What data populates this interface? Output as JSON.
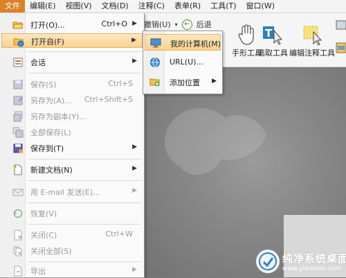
{
  "menubar": {
    "items": [
      "文件",
      "编辑(E)",
      "视图(V)",
      "文档(D)",
      "注释(C)",
      "表单(R)",
      "工具(T)",
      "窗口(W)"
    ]
  },
  "ribbon": {
    "undo": "撤销(U)",
    "back": "后退",
    "tools": [
      "手形工具",
      "选取工具",
      "编辑注释工具"
    ]
  },
  "menu": {
    "items": [
      {
        "label": "打开(O)...",
        "shortcut": "Ctrl+O",
        "arrow": true,
        "icon": "folder-open-icon",
        "disabled": false
      },
      {
        "label": "打开自(F)",
        "shortcut": "",
        "arrow": true,
        "icon": "folder-web-icon",
        "disabled": false
      },
      {
        "label": "会话",
        "shortcut": "",
        "arrow": true,
        "icon": "session-icon",
        "disabled": false
      },
      {
        "label": "保存(S)",
        "shortcut": "Ctrl+S",
        "arrow": false,
        "icon": "save-icon",
        "disabled": true
      },
      {
        "label": "另存为(A)...",
        "shortcut": "Ctrl+Shift+S",
        "arrow": false,
        "icon": "save-as-icon",
        "disabled": true
      },
      {
        "label": "另存为副本(Y)...",
        "shortcut": "",
        "arrow": false,
        "icon": "save-copy-icon",
        "disabled": true
      },
      {
        "label": "全部保存(L)",
        "shortcut": "",
        "arrow": false,
        "icon": "save-all-icon",
        "disabled": true
      },
      {
        "label": "保存到(T)",
        "shortcut": "",
        "arrow": true,
        "icon": "save-to-icon",
        "disabled": false
      },
      {
        "label": "新建文档(N)",
        "shortcut": "",
        "arrow": true,
        "icon": "new-document-icon",
        "disabled": false
      },
      {
        "label": "用 E-mail 发送(E)...",
        "shortcut": "",
        "arrow": true,
        "icon": "email-icon",
        "disabled": true
      },
      {
        "label": "恢复(V)",
        "shortcut": "",
        "arrow": false,
        "icon": "revert-icon",
        "disabled": true
      },
      {
        "label": "关闭(C)",
        "shortcut": "Ctrl+W",
        "arrow": false,
        "icon": "close-document-icon",
        "disabled": true
      },
      {
        "label": "关闭全部(S)",
        "shortcut": "",
        "arrow": false,
        "icon": "close-all-icon",
        "disabled": true
      },
      {
        "label": "导出",
        "shortcut": "",
        "arrow": true,
        "icon": "export-icon",
        "disabled": true
      }
    ]
  },
  "submenu": {
    "items": [
      {
        "label": "我的计算机(M)",
        "icon": "computer-icon",
        "arrow": false
      },
      {
        "label": "URL(U)...",
        "icon": "globe-icon",
        "arrow": false
      },
      {
        "label": "添加位置",
        "icon": "add-location-icon",
        "arrow": true
      }
    ]
  },
  "watermark": {
    "title": "纯净系统桌面",
    "url": "www.yidaimei.com"
  }
}
